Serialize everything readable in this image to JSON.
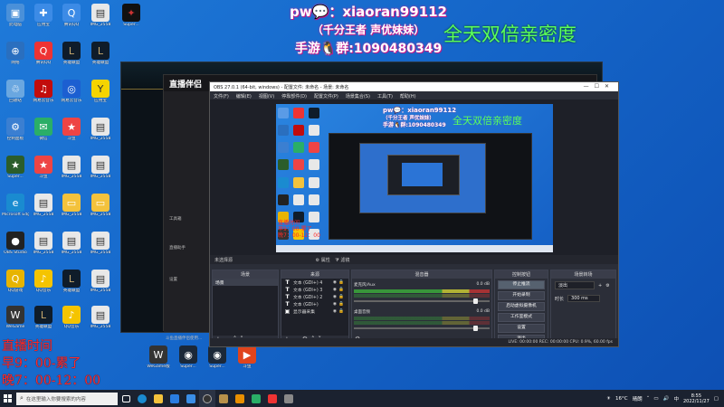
{
  "overlay": {
    "line1": "pw💬：xiaoran99112",
    "line2": "（千分王者 声优妹妹）",
    "line3": "手游🐧群:1090480349",
    "right": "全天双倍亲密度"
  },
  "schedule": {
    "title": "直播时间",
    "line1": "早9：00-累了",
    "line2": "晚7：00-12：00"
  },
  "desktop_icons": [
    {
      "label": "此电脑",
      "color": "#4a90d9",
      "glyph": "▣"
    },
    {
      "label": "回收站",
      "color": "#6aa7e0",
      "glyph": "♲"
    },
    {
      "label": "网络",
      "color": "#2a6fbf",
      "glyph": "⊕"
    },
    {
      "label": "控制面板",
      "color": "#3b7fd1",
      "glyph": "⚙"
    },
    {
      "label": "Super...",
      "color": "#2b5d2b",
      "glyph": "★"
    },
    {
      "label": "Microsoft Edge",
      "color": "#1a8bd0",
      "glyph": "e"
    },
    {
      "label": "OBS Studio",
      "color": "#222",
      "glyph": "●"
    },
    {
      "label": "QQ游戏",
      "color": "#e7b400",
      "glyph": "Q"
    },
    {
      "label": "WeGame",
      "color": "#333",
      "glyph": "W"
    },
    {
      "label": "应用宝",
      "color": "#3c8be6",
      "glyph": "✚"
    },
    {
      "label": "腾讯QQ",
      "color": "#e33",
      "glyph": "Q"
    },
    {
      "label": "网易云音乐",
      "color": "#c20c0c",
      "glyph": "♫"
    },
    {
      "label": "微信",
      "color": "#2aae67",
      "glyph": "✉"
    },
    {
      "label": "斗鱼",
      "color": "#e44",
      "glyph": "★"
    },
    {
      "label": "英雄联盟",
      "color": "#0f1c2a",
      "glyph": "L"
    },
    {
      "label": "IMG_2558",
      "color": "#e8e8e8",
      "glyph": "▤"
    },
    {
      "label": "QQ音乐",
      "color": "#f5c400",
      "glyph": "♪"
    },
    {
      "label": "WeGame版",
      "color": "#222",
      "glyph": "W"
    }
  ],
  "obs": {
    "title": "OBS 27.0.1 (64-bit, windows) - 配置文件: 未命名 - 场景: 未命名",
    "menu": [
      "文件(F)",
      "编辑(E)",
      "视图(V)",
      "停靠部件(D)",
      "配置文件(P)",
      "场景集合(S)",
      "工具(T)",
      "帮助(H)"
    ],
    "no_source": "未选择源",
    "properties": "属性",
    "filters": "滤镜",
    "docks": {
      "scenes": "场景",
      "sources": "来源",
      "mixer": "混音器",
      "transitions": "场景转场",
      "controls": "控制按钮"
    },
    "scene_item": "场景",
    "sources": [
      {
        "icon": "T",
        "name": "文本 (GDI+) 4"
      },
      {
        "icon": "T",
        "name": "文本 (GDI+) 3"
      },
      {
        "icon": "T",
        "name": "文本 (GDI+) 2"
      },
      {
        "icon": "T",
        "name": "文本 (GDI+)"
      },
      {
        "icon": "▣",
        "name": "显示器采集"
      }
    ],
    "mixer": [
      {
        "name": "麦克风/Aux",
        "value": "0.0 dB"
      },
      {
        "name": "桌面音频",
        "value": "0.0 dB"
      }
    ],
    "controls": [
      "停止推流",
      "开始录制",
      "启动虚拟摄像机",
      "工作室模式",
      "设置",
      "退出"
    ],
    "transition": {
      "type": "淡出",
      "duration_label": "时长",
      "duration": "300 ms"
    },
    "status": "LIVE: 00:00:00    REC: 00:00:00    CPU: 0.9%, 60.00 fps"
  },
  "live_window": {
    "title": "直播伴侣",
    "side_items": [
      "工具箱",
      "直播助手",
      "设置"
    ],
    "footer": "斗鱼直播伴侣使用..."
  },
  "taskbar": {
    "search_placeholder": "在这里输入你要搜索的内容",
    "temp": "16°C",
    "weather": "晴朗",
    "time": "8:55",
    "date": "2022/11/27",
    "apps": [
      {
        "name": "task-view",
        "color": "#fff"
      },
      {
        "name": "edge",
        "color": "#1a8bd0"
      },
      {
        "name": "explorer",
        "color": "#f3c23c"
      },
      {
        "name": "store",
        "color": "#2a7de1"
      },
      {
        "name": "mail",
        "color": "#3a8ee6"
      },
      {
        "name": "obs",
        "color": "#333"
      },
      {
        "name": "lol",
        "color": "#b8914a"
      },
      {
        "name": "douyu",
        "color": "#e88f00"
      },
      {
        "name": "wechat",
        "color": "#2aae67"
      },
      {
        "name": "qq",
        "color": "#e33"
      },
      {
        "name": "app2",
        "color": "#888"
      }
    ]
  }
}
